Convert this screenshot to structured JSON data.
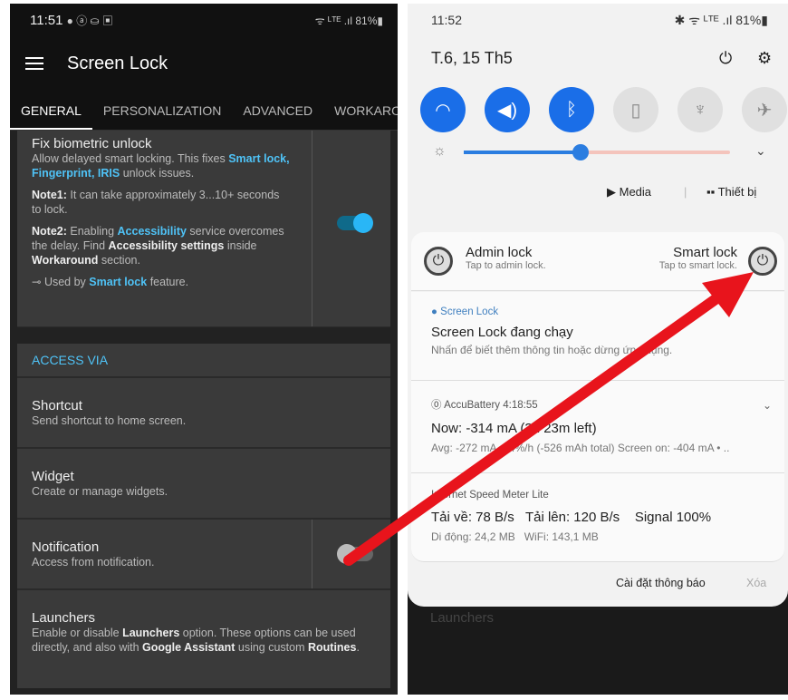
{
  "left": {
    "status_time": "11:51",
    "status_icons": "● ⓐ ⛀ ▣",
    "status_right": "ᯤ ᴸᵀᴱ .ıl 81%▮",
    "title": "Screen Lock",
    "tabs": [
      "GENERAL",
      "PERSONALIZATION",
      "ADVANCED",
      "WORKAROUND"
    ],
    "fix": {
      "title": "Fix biometric unlock",
      "desc1": "Allow delayed smart locking. This fixes ",
      "desc_link": "Smart lock, Fingerprint, IRIS",
      "desc2": " unlock issues.",
      "n1_label": "Note1:",
      "n1": " It can take approximately 3...10+ seconds to lock.",
      "n2_label": "Note2:",
      "n2a": " Enabling ",
      "n2_link": "Accessibility",
      "n2b": " service overcomes the delay. Find ",
      "n2_bold": "Accessibility settings",
      "n2c": " inside ",
      "n2_bold2": "Workaround",
      "n2d": " section.",
      "used_a": "Used by ",
      "used_link": "Smart lock",
      "used_b": " feature."
    },
    "section": "ACCESS VIA",
    "shortcut": {
      "title": "Shortcut",
      "desc": "Send shortcut to home screen."
    },
    "widget": {
      "title": "Widget",
      "desc": "Create or manage widgets."
    },
    "notification": {
      "title": "Notification",
      "desc": "Access from notification."
    },
    "launchers": {
      "title": "Launchers",
      "d1": "Enable or disable ",
      "b1": "Launchers",
      "d2": " option. These options can be used directly, and also with ",
      "b2": "Google Assistant",
      "d3": " using custom ",
      "b3": "Routines",
      "d4": "."
    }
  },
  "right": {
    "status_time": "11:52",
    "status_right": "✱ ᯤ ᴸᵀᴱ .ıl 81%▮",
    "date": "T.6, 15 Th5",
    "media": "Media",
    "devices": "Thiết bị",
    "admin": {
      "title": "Admin lock",
      "sub": "Tap to admin lock."
    },
    "smart": {
      "title": "Smart lock",
      "sub": "Tap to smart lock."
    },
    "sl": {
      "app": "Screen Lock",
      "title": "Screen Lock đang chạy",
      "sub": "Nhấn để biết thêm thông tin hoặc dừng ứng dụng."
    },
    "ab": {
      "app": "AccuBattery 4:18:55",
      "title": "Now: -314 mA (3h 23m left)",
      "sub": "Avg: -272 mA, 24%/h (-526 mAh total) Screen on: -404 mA • .."
    },
    "ism": {
      "app": "Internet Speed Meter Lite",
      "title": "Tải về: 78 B/s   Tải lên: 120 B/s    Signal 100%",
      "sub": "Di động: 24,2 MB   WiFi: 143,1 MB"
    },
    "settings": "Cài đặt thông báo",
    "clear": "Xóa"
  }
}
